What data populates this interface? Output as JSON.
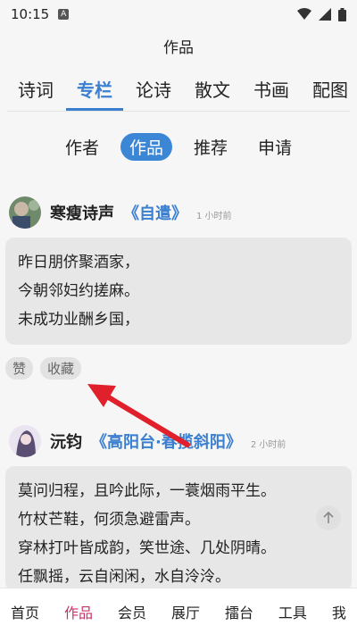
{
  "status": {
    "time": "10:15",
    "notif_letter": "A"
  },
  "header": {
    "title": "作品"
  },
  "tabs": [
    {
      "label": "诗词"
    },
    {
      "label": "专栏"
    },
    {
      "label": "论诗"
    },
    {
      "label": "散文"
    },
    {
      "label": "书画"
    },
    {
      "label": "配图"
    }
  ],
  "subtabs": [
    {
      "label": "作者"
    },
    {
      "label": "作品"
    },
    {
      "label": "推荐"
    },
    {
      "label": "申请"
    }
  ],
  "posts": [
    {
      "author": "寒瘦诗声",
      "title": "《自遣》",
      "time": "1 小时前",
      "lines": [
        "昨日朋侪聚酒家，",
        "今朝邻妇约搓麻。",
        "未成功业酬乡国，"
      ],
      "actions": {
        "like": "赞",
        "collect": "收藏"
      }
    },
    {
      "author": "沅钧",
      "title": "《高阳台·春揽斜阳》",
      "time": "2 小时前",
      "lines": [
        "莫问归程，且吟此际，一蓑烟雨平生。",
        "竹杖芒鞋，何须急避雷声。",
        "穿林打叶皆成韵，笑世途、几处阴晴。",
        "任飘摇，云自闲闲，水自泠泠。"
      ]
    }
  ],
  "bottom_nav": [
    {
      "label": "首页"
    },
    {
      "label": "作品"
    },
    {
      "label": "会员"
    },
    {
      "label": "展厅"
    },
    {
      "label": "擂台"
    },
    {
      "label": "工具"
    },
    {
      "label": "我"
    }
  ],
  "colors": {
    "accent": "#3b7fd0",
    "active_nav": "#c8326a",
    "arrow": "#e0202a"
  }
}
